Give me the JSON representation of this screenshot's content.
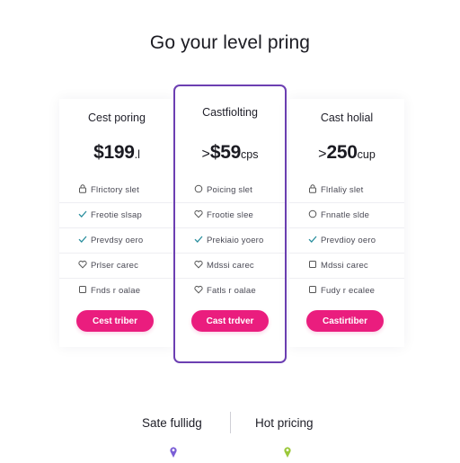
{
  "header": {
    "title": "Go your level pring"
  },
  "plans": [
    {
      "name": "Cest poring",
      "price": "$199",
      "price_suffix": ".l",
      "price_prefix": "",
      "features": [
        {
          "icon": "lock-icon",
          "text": "Flrictory slet"
        },
        {
          "icon": "check-icon",
          "text": "Freotie slsap"
        },
        {
          "icon": "check-icon",
          "text": "Prevdsy oero"
        },
        {
          "icon": "heart-icon",
          "text": "Prlser carec"
        },
        {
          "icon": "square-icon",
          "text": "Fnds r oalae"
        }
      ],
      "cta": "Cest triber"
    },
    {
      "name": "Castfiolting",
      "price": "$59",
      "price_suffix": "cps",
      "price_prefix": ">",
      "features": [
        {
          "icon": "circle-icon",
          "text": "Poicing slet"
        },
        {
          "icon": "heart-icon",
          "text": "Frootie slee"
        },
        {
          "icon": "check-icon",
          "text": "Prekiaio yoero"
        },
        {
          "icon": "heart-icon",
          "text": "Mdssi carec"
        },
        {
          "icon": "heart-icon",
          "text": "Fatls r oalae"
        }
      ],
      "cta": "Cast trdver"
    },
    {
      "name": "Cast holial",
      "price": "250",
      "price_suffix": "cup",
      "price_prefix": ">",
      "features": [
        {
          "icon": "lock-icon",
          "text": "Flrlaliy slet"
        },
        {
          "icon": "circle-icon",
          "text": "Fnnatle slde"
        },
        {
          "icon": "check-icon",
          "text": "Prevdioy oero"
        },
        {
          "icon": "square-icon",
          "text": "Mdssi carec"
        },
        {
          "icon": "square-icon",
          "text": "Fudy r ecalee"
        }
      ],
      "cta": "Castirtiber"
    }
  ],
  "footer": {
    "left_link": "Sate fullidg",
    "right_link": "Hot pricing"
  },
  "colors": {
    "accent": "#ea1d7e",
    "highlight_border": "#6c3fb2",
    "check": "#2b8f9e",
    "pin_left": "#7b5fd6",
    "pin_right": "#9bc83a"
  }
}
